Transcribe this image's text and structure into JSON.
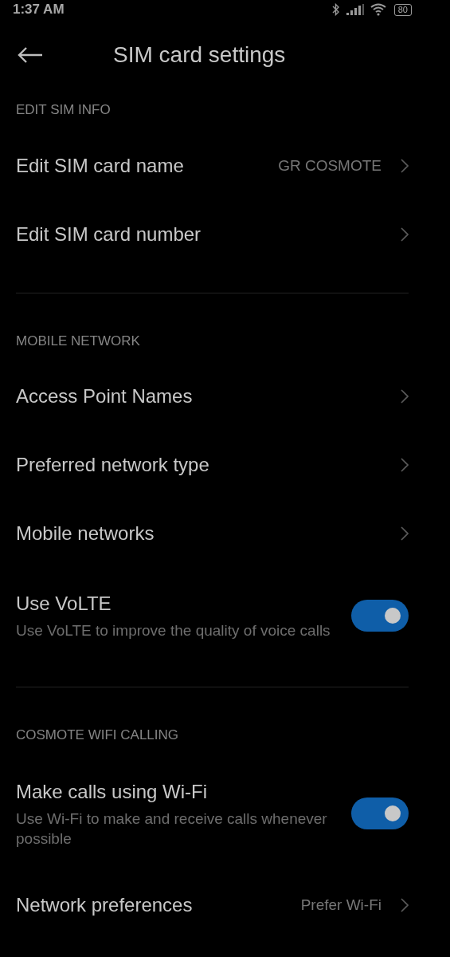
{
  "status_bar": {
    "time": "1:37 AM",
    "battery": "80"
  },
  "header": {
    "title": "SIM card settings"
  },
  "sections": [
    {
      "label": "EDIT SIM INFO",
      "items": [
        {
          "kind": "nav",
          "title": "Edit SIM card name",
          "value": "GR COSMOTE"
        },
        {
          "kind": "nav",
          "title": "Edit SIM card number"
        }
      ]
    },
    {
      "label": "MOBILE NETWORK",
      "items": [
        {
          "kind": "nav",
          "title": "Access Point Names"
        },
        {
          "kind": "nav",
          "title": "Preferred network type"
        },
        {
          "kind": "nav",
          "title": "Mobile networks"
        },
        {
          "kind": "toggle",
          "title": "Use VoLTE",
          "subtitle": "Use VoLTE to improve the quality of voice calls",
          "on": true
        }
      ]
    },
    {
      "label": "COSMOTE WIFI CALLING",
      "items": [
        {
          "kind": "toggle",
          "title": "Make calls using Wi-Fi",
          "subtitle": "Use Wi-Fi to make and receive calls whenever possible",
          "on": true
        },
        {
          "kind": "nav",
          "title": "Network preferences",
          "value": "Prefer Wi-Fi"
        }
      ]
    }
  ]
}
